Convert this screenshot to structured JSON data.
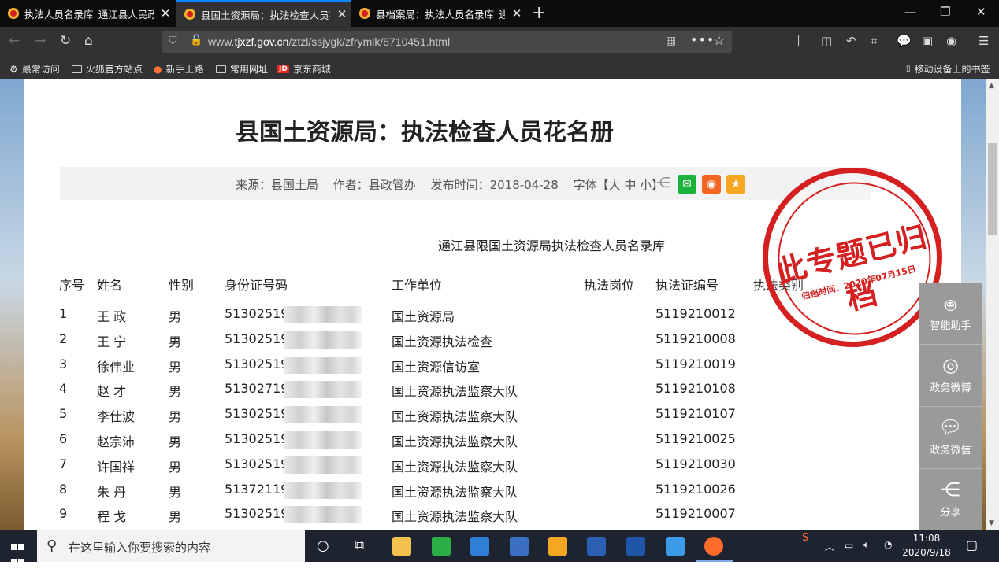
{
  "browser": {
    "tabs": [
      {
        "title": "执法人员名录库_通江县人民政府"
      },
      {
        "title": "县国土资源局：执法检查人员花名册"
      },
      {
        "title": "县档案局：执法人员名录库_通江县"
      }
    ],
    "active_tab": 1,
    "url_prefix": "www.",
    "url_host": "tjxzf.gov.cn",
    "url_path": "/ztzl/ssjygk/zfrymlk/8710451.html",
    "bookmarks": [
      {
        "label": "最常访问"
      },
      {
        "label": "火狐官方站点"
      },
      {
        "label": "新手上路"
      },
      {
        "label": "常用网址"
      },
      {
        "label": "京东商城"
      }
    ],
    "mobile_bookmarks": "移动设备上的书签",
    "jd_logo": "JD"
  },
  "page": {
    "title": "县国土资源局：执法检查人员花名册",
    "meta": {
      "source": "来源：县国土局",
      "author": "作者：县政管办",
      "date": "发布时间：2018-04-28",
      "font_size": "字体【大 中 小】"
    },
    "stamp": {
      "main": "此专题已归档",
      "date": "归档时间：2020年07月15日"
    },
    "subtitle": "通江县限国土资源局执法检查人员名录库",
    "table": {
      "headers": [
        "序号",
        "姓名",
        "性别",
        "身份证号码",
        "工作单位",
        "执法岗位",
        "执法证编号",
        "执法类别"
      ],
      "rows": [
        [
          "1",
          "王 政",
          "男",
          "51302519",
          "国土资源局",
          "",
          "5119210012",
          ""
        ],
        [
          "2",
          "王 宁",
          "男",
          "51302519",
          "国土资源执法检查",
          "",
          "5119210008",
          ""
        ],
        [
          "3",
          "徐伟业",
          "男",
          "51302519",
          "国土资源信访室",
          "",
          "5119210019",
          ""
        ],
        [
          "4",
          "赵 才",
          "男",
          "51302719",
          "国土资源执法监察大队",
          "",
          "5119210108",
          ""
        ],
        [
          "5",
          "李仕波",
          "男",
          "51302519",
          "国土资源执法监察大队",
          "",
          "5119210107",
          ""
        ],
        [
          "6",
          "赵宗沛",
          "男",
          "51302519",
          "国土资源执法监察大队",
          "",
          "5119210025",
          ""
        ],
        [
          "7",
          "许国祥",
          "男",
          "51302519",
          "国土资源执法监察大队",
          "",
          "5119210030",
          ""
        ],
        [
          "8",
          "朱 丹",
          "男",
          "51372119",
          "国土资源执法监察大队",
          "",
          "5119210026",
          ""
        ],
        [
          "9",
          "程 戈",
          "男",
          "51302519",
          "国土资源执法监察大队",
          "",
          "5119210007",
          ""
        ]
      ]
    }
  },
  "side_menu": [
    {
      "label": "智能助手",
      "icon": "robot-icon"
    },
    {
      "label": "政务微博",
      "icon": "weibo-icon"
    },
    {
      "label": "政务微信",
      "icon": "wechat-icon"
    },
    {
      "label": "分享",
      "icon": "share-icon"
    }
  ],
  "taskbar": {
    "search_placeholder": "在这里输入你要搜索的内容",
    "time": "11:08",
    "date": "2020/9/18"
  }
}
